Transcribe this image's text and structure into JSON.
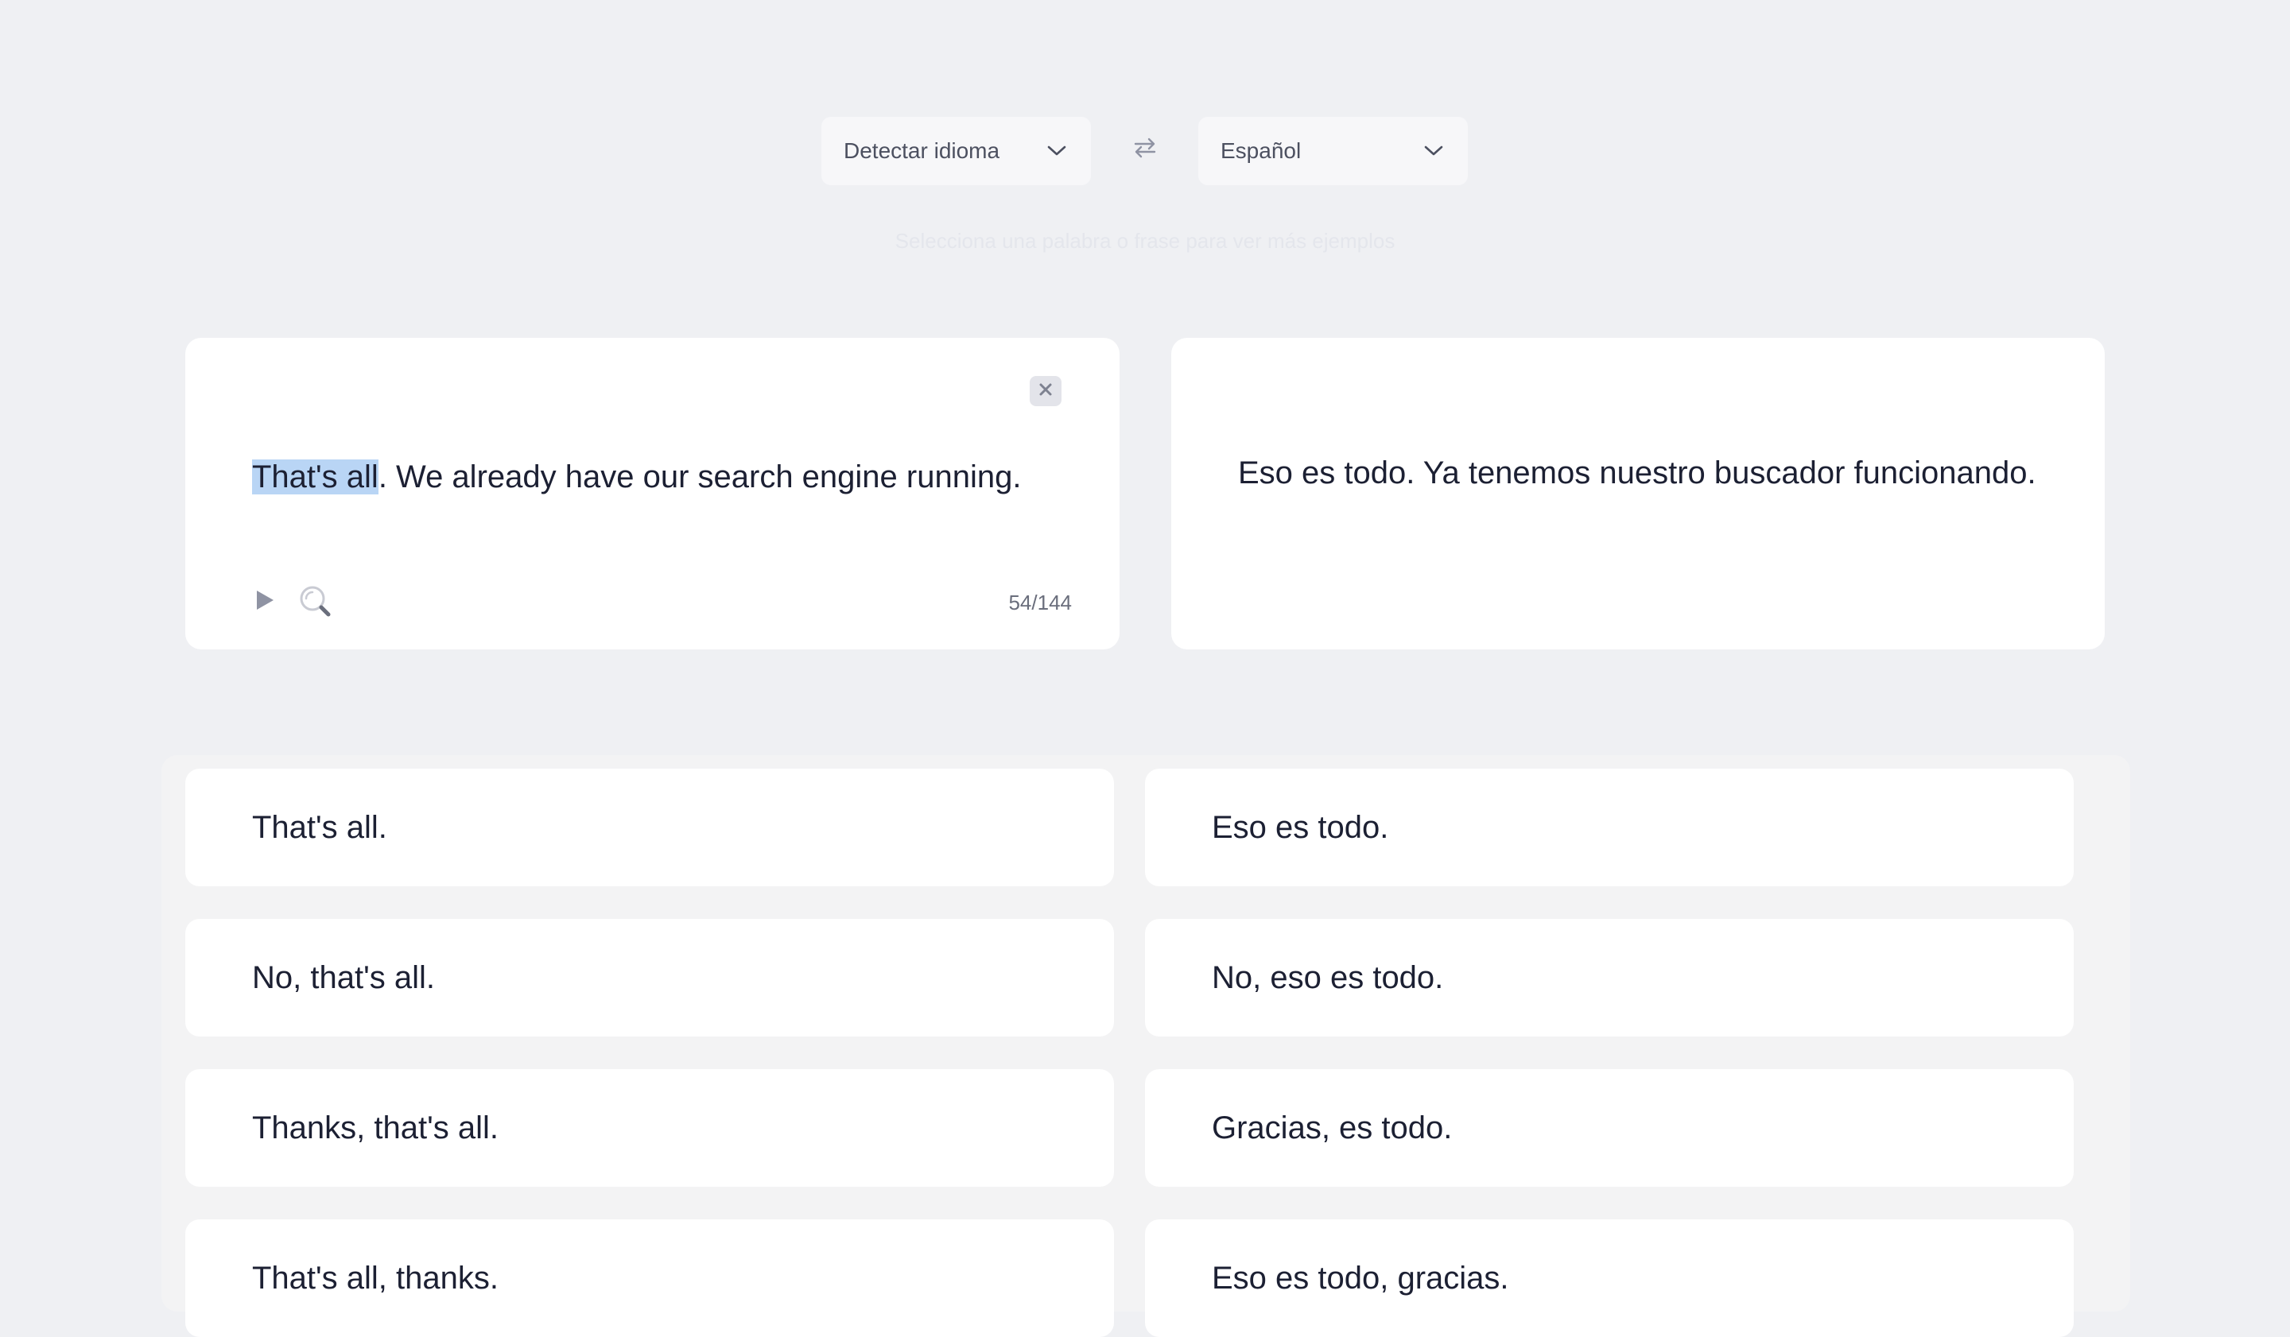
{
  "languages": {
    "source": "Detectar idioma",
    "target": "Español"
  },
  "hint": "Selecciona una palabra o frase para ver más ejemplos",
  "source": {
    "highlighted": "That's all",
    "rest": ". We already have our search engine running.",
    "char_count": "54/144"
  },
  "target": {
    "text": "Eso es todo. Ya tenemos nuestro buscador funcionando."
  },
  "examples": [
    {
      "source": "That's all.",
      "target": "Eso es todo."
    },
    {
      "source": "No, that's all.",
      "target": "No, eso es todo."
    },
    {
      "source": "Thanks, that's all.",
      "target": "Gracias, es todo."
    },
    {
      "source": "That's all, thanks.",
      "target": "Eso es todo, gracias."
    }
  ],
  "icons": {
    "clear": "close-icon",
    "swap": "swap-icon",
    "play": "play-icon",
    "lookup": "search-icon",
    "dropdown": "chevron-down-icon"
  },
  "colors": {
    "background": "#eff0f3",
    "card": "#ffffff",
    "highlight": "#b9d5f5",
    "text": "#1c2033",
    "muted": "#6a6e7c"
  }
}
